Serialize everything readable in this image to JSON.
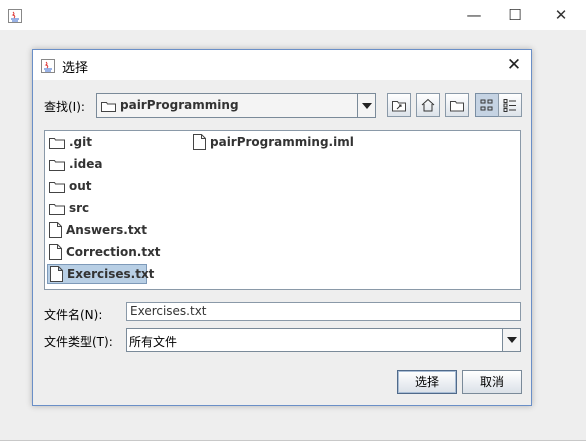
{
  "dialog": {
    "title": "选择"
  },
  "look_in": {
    "label": "查找(I):",
    "value": "pairProgramming"
  },
  "toolbar": {
    "buttons": [
      "up-one-level",
      "home",
      "new-folder",
      "list-view",
      "details-view"
    ]
  },
  "files": [
    {
      "name": ".git",
      "type": "folder"
    },
    {
      "name": ".idea",
      "type": "folder"
    },
    {
      "name": "out",
      "type": "folder"
    },
    {
      "name": "src",
      "type": "folder"
    },
    {
      "name": "Answers.txt",
      "type": "file"
    },
    {
      "name": "Correction.txt",
      "type": "file"
    },
    {
      "name": "Exercises.txt",
      "type": "file",
      "selected": true
    },
    {
      "name": "pairProgramming.iml",
      "type": "file"
    }
  ],
  "file_name": {
    "label": "文件名(N):",
    "value": "Exercises.txt"
  },
  "file_type": {
    "label": "文件类型(T):",
    "value": "所有文件"
  },
  "buttons": {
    "approve": "选择",
    "cancel": "取消"
  },
  "colors": {
    "selection": "#b8cfe5",
    "dialog_border": "#6a8fc7"
  }
}
